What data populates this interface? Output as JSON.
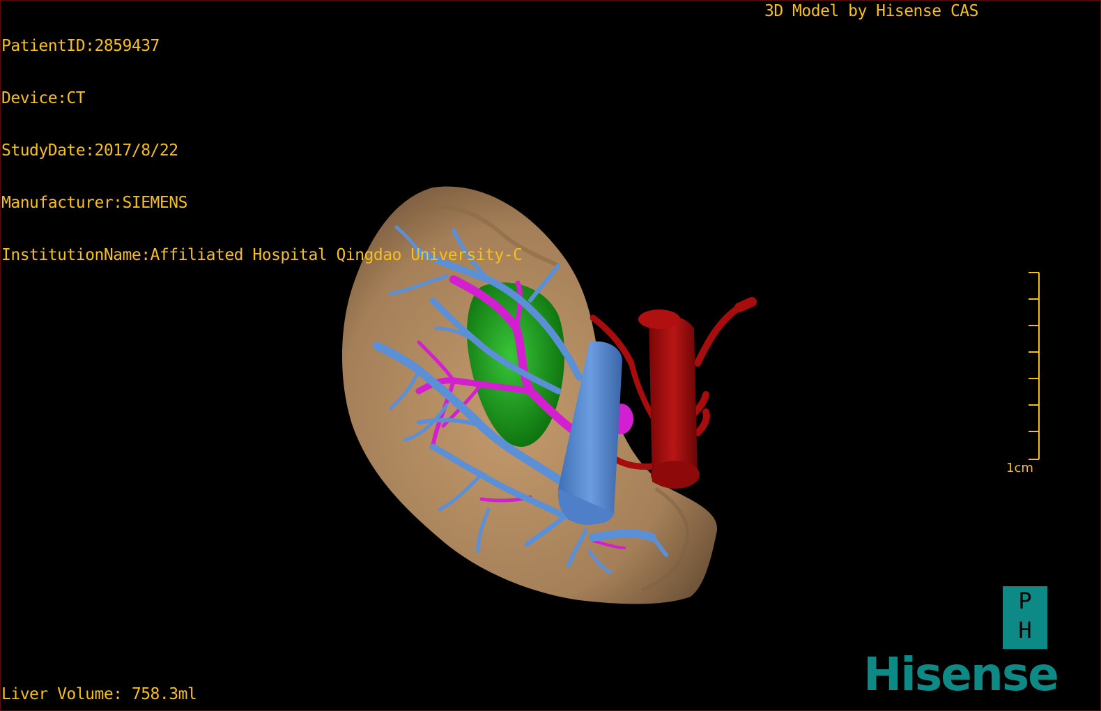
{
  "patient_info": [
    "PatientID:2859437",
    "Device:CT",
    "StudyDate:2017/8/22",
    "Manufacturer:SIEMENS",
    "InstitutionName:Affiliated Hospital Qingdao University-C"
  ],
  "brand_caption": "3D Model by Hisense CAS",
  "scale_bar": {
    "label": "1cm",
    "ticks": 7
  },
  "liver_volume_text": "Liver Volume: 758.3ml",
  "logo": {
    "badge_top": "P",
    "badge_bottom": "H",
    "wordmark": "Hisense",
    "color": "#0d8a86"
  },
  "overlay_color": "#f5c01e",
  "model_colors": {
    "liver": "#a9855e",
    "hepatic_vein": "#5b8fd6",
    "portal_vein": "#d21fd0",
    "tumor": "#1a9a1a",
    "artery": "#a80d0d"
  }
}
